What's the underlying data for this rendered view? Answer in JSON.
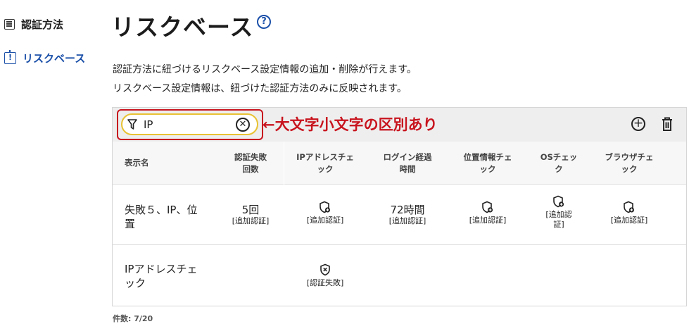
{
  "sidebar": {
    "items": [
      {
        "label": "認証方法",
        "icon": "list-icon"
      },
      {
        "label": "リスクベース",
        "icon": "alert-box-icon",
        "active": true
      }
    ]
  },
  "page": {
    "title": "リスクベース",
    "help_icon": "help-circle-icon",
    "description": [
      "認証方法に紐づけるリスクベース設定情報の追加・削除が行えます。",
      "リスクベース設定情報は、紐づけた認証方法のみに反映されます。"
    ]
  },
  "toolbar": {
    "filter_icon": "filter-icon",
    "filter_value": "IP",
    "clear_icon": "clear-circle-icon",
    "annotation": "←大文字小文字の区別あり",
    "add_icon": "add-circle-icon",
    "delete_icon": "trash-icon"
  },
  "table": {
    "headers": {
      "name": "表示名",
      "fail_count": [
        "認証失敗",
        "回数"
      ],
      "ip": [
        "IPアドレスチェ",
        "ック"
      ],
      "elapsed": [
        "ログイン経過",
        "時間"
      ],
      "location": [
        "位置情報チェ",
        "ック"
      ],
      "os": [
        "OSチェッ",
        "ク"
      ],
      "browser": [
        "ブラウザチェ",
        "ック"
      ]
    },
    "rows": [
      {
        "name": [
          "失敗５、IP、位",
          "置"
        ],
        "fail_count": {
          "value": "5回",
          "action": "[追加認証]"
        },
        "ip": {
          "icon": "shield-plus-icon",
          "action": "[追加認証]"
        },
        "elapsed": {
          "value": "72時間",
          "action": "[追加認証]"
        },
        "location": {
          "icon": "shield-plus-icon",
          "action": "[追加認証]"
        },
        "os": {
          "icon": "shield-plus-icon",
          "action": [
            "[追加認",
            "証]"
          ]
        },
        "browser": {
          "icon": "shield-plus-icon",
          "action": "[追加認証]"
        }
      },
      {
        "name": [
          "IPアドレスチェ",
          "ック"
        ],
        "ip": {
          "icon": "shield-x-icon",
          "action": "[認証失敗]"
        }
      }
    ]
  },
  "footer": {
    "count_text": "件数: 7/20"
  },
  "colors": {
    "accent_blue": "#1a4fa8",
    "annotation_red": "#c8141e",
    "filter_border_yellow": "#e8c233"
  }
}
